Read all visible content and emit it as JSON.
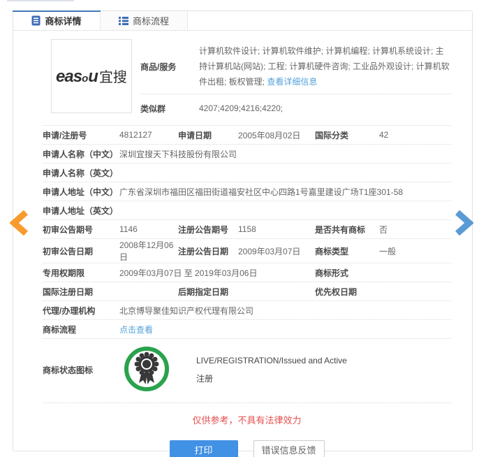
{
  "colors": {
    "accent_blue": "#3f7ab8",
    "link_blue": "#54a1d8",
    "button_blue": "#4191e4",
    "arrow_orange": "#f79b2e",
    "arrow_blue": "#5b9bd5",
    "badge_green": "#2ba24d",
    "alert_red": "#e5504f"
  },
  "tabs": {
    "detail": {
      "label": "商标详情",
      "icon": "document-icon",
      "active": true
    },
    "process": {
      "label": "商标流程",
      "icon": "list-icon",
      "active": false
    }
  },
  "logo": {
    "part1": "eas",
    "part2": "o",
    "part3": "u",
    "part4": "宜搜",
    "full": "easou宜搜"
  },
  "goods": {
    "label": "商品/服务",
    "value": "计算机软件设计; 计算机软件维护; 计算机编程; 计算机系统设计; 主持计算机站(网站); 工程; 计算机硬件咨询; 工业品外观设计; 计算机软件出租; 板权管理;",
    "link": "查看详细信息"
  },
  "similar_group": {
    "label": "类似群",
    "value": "4207;4209;4216;4220;"
  },
  "fields": {
    "reg_no": {
      "label": "申请/注册号",
      "value": "4812127"
    },
    "app_date": {
      "label": "申请日期",
      "value": "2005年08月02日"
    },
    "intl_class": {
      "label": "国际分类",
      "value": "42"
    },
    "applicant_cn": {
      "label": "申请人名称（中文）",
      "value": "深圳宜搜天下科技股份有限公司"
    },
    "applicant_en": {
      "label": "申请人名称（英文）",
      "value": ""
    },
    "address_cn": {
      "label": "申请人地址（中文）",
      "value": "广东省深圳市福田区福田街道福安社区中心四路1号嘉里建设广场T1座301-58"
    },
    "address_en": {
      "label": "申请人地址（英文）",
      "value": ""
    },
    "first_gazette_no": {
      "label": "初审公告期号",
      "value": "1146"
    },
    "reg_gazette_no": {
      "label": "注册公告期号",
      "value": "1158"
    },
    "is_shared": {
      "label": "是否共有商标",
      "value": "否"
    },
    "first_gazette_date": {
      "label": "初审公告日期",
      "value": "2008年12月06日"
    },
    "reg_gazette_date": {
      "label": "注册公告日期",
      "value": "2009年03月07日"
    },
    "tm_type": {
      "label": "商标类型",
      "value": "一般"
    },
    "exclusive_period": {
      "label": "专用权期限",
      "value": "2009年03月07日 至 2019年03月06日"
    },
    "tm_form": {
      "label": "商标形式",
      "value": ""
    },
    "intl_reg_date": {
      "label": "国际注册日期",
      "value": ""
    },
    "later_designation_date": {
      "label": "后期指定日期",
      "value": ""
    },
    "priority_date": {
      "label": "优先权日期",
      "value": ""
    },
    "agency": {
      "label": "代理/办理机构",
      "value": "北京博导聚佳知识产权代理有限公司"
    },
    "process": {
      "label": "商标流程",
      "link": "点击查看"
    }
  },
  "status": {
    "label": "商标状态图标",
    "icon": "medal-icon",
    "line_en": "LIVE/REGISTRATION/Issued and Active",
    "line_cn": "注册"
  },
  "footer": {
    "disclaimer": "仅供参考，不具有法律效力",
    "print_label": "打印",
    "feedback_label": "错误信息反馈"
  },
  "nav": {
    "prev_icon": "chevron-left-icon",
    "next_icon": "chevron-right-icon"
  }
}
